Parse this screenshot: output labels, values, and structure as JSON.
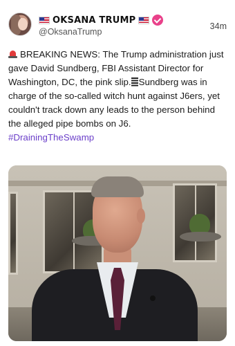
{
  "post": {
    "display_name": "OKSANA TRUMP",
    "handle": "@OksanaTrump",
    "timestamp": "34m",
    "icons": [
      "avatar",
      "us-flag-icon",
      "us-flag-icon",
      "verified-badge-icon",
      "siren-icon",
      "bars-icon"
    ],
    "text_part1": "BREAKING NEWS: The Trump administration just gave David Sundberg, FBI Assistant Director for Washington, DC, the pink slip.",
    "text_part2": "Sundberg was in charge of the so-called witch hunt against J6ers, yet couldn't track down any leads to the person behind the alleged pipe bombs on J6.",
    "hashtag": "#DrainingTheSwamp",
    "media": {
      "type": "photo"
    }
  },
  "colors": {
    "verified_badge": "#e9418a",
    "hashtag": "#6b3fc9",
    "siren": "#e23b3b"
  }
}
